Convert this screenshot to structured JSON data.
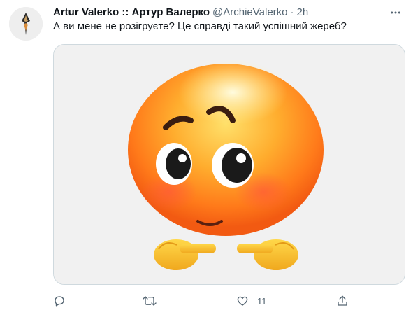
{
  "tweet": {
    "display_name": "Artur Valerko :: Артур Валерко",
    "handle": "@ArchieValerko",
    "separator": "·",
    "time": "2h",
    "text": "А ви мене не розігруєте? Це справді такий успішний жереб?",
    "more_icon": "more-horizontal-icon",
    "avatar_icon": "avatar-image"
  },
  "actions": {
    "reply": {
      "icon": "reply-icon",
      "count": ""
    },
    "retweet": {
      "icon": "retweet-icon",
      "count": ""
    },
    "like": {
      "icon": "heart-icon",
      "count": "11"
    },
    "share": {
      "icon": "share-icon",
      "count": ""
    }
  },
  "colors": {
    "text": "#0f1419",
    "secondary": "#536471",
    "border": "#cfd9de"
  }
}
